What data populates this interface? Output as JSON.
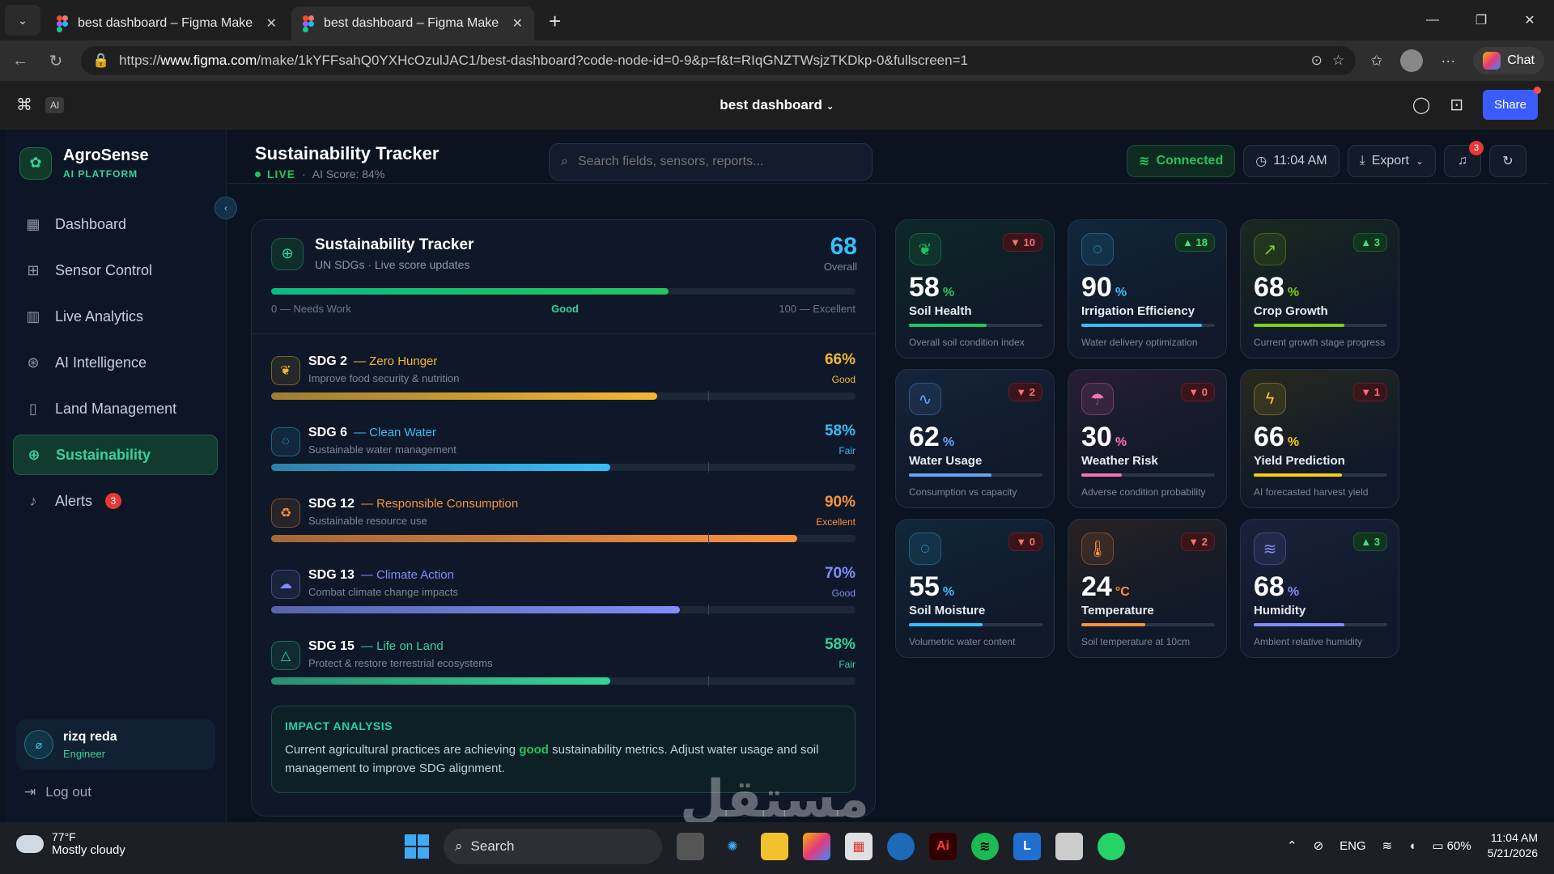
{
  "browser": {
    "tabs": [
      {
        "title": "best dashboard – Figma Make",
        "active": false
      },
      {
        "title": "best dashboard – Figma Make",
        "active": true
      }
    ],
    "url_prefix": "https://",
    "url_domain": "www.figma.com",
    "url_path": "/make/1kYFFsahQ0YXHcOzulJAC1/best-dashboard?code-node-id=0-9&p=f&t=RIqGNZTWsjzTKDkp-0&fullscreen=1",
    "chat_label": "Chat"
  },
  "figma": {
    "ai_chip": "AI",
    "file_title": "best dashboard",
    "share_label": "Share"
  },
  "sidebar": {
    "brand_name": "AgroSense",
    "brand_sub": "AI PLATFORM",
    "items": [
      {
        "label": "Dashboard",
        "icon": "grid-icon"
      },
      {
        "label": "Sensor Control",
        "icon": "cpu-icon"
      },
      {
        "label": "Live Analytics",
        "icon": "bar-chart-icon"
      },
      {
        "label": "AI Intelligence",
        "icon": "brain-icon"
      },
      {
        "label": "Land Management",
        "icon": "map-icon"
      },
      {
        "label": "Sustainability",
        "icon": "globe-icon",
        "active": true
      },
      {
        "label": "Alerts",
        "icon": "bell-icon",
        "badge": "3"
      }
    ],
    "user_name": "rizq reda",
    "user_role": "Engineer",
    "logout_label": "Log out"
  },
  "header": {
    "title": "Sustainability Tracker",
    "live": "LIVE",
    "separator": "·",
    "ai_score": "AI Score: 84%",
    "search_placeholder": "Search fields, sensors, reports...",
    "connected": "Connected",
    "time": "11:04 AM",
    "export": "Export",
    "notif_count": "3"
  },
  "tracker": {
    "title": "Sustainability Tracker",
    "subtitle": "UN SDGs · Live score updates",
    "score": "68",
    "score_label": "Overall",
    "overall_fraction": 0.68,
    "scale_low": "0 — Needs Work",
    "scale_mid": "Good",
    "scale_high": "100 — Excellent",
    "sdgs": [
      {
        "code": "SDG 2",
        "name": "— Zero Hunger",
        "desc": "Improve food security & nutrition",
        "pct": "66%",
        "level": "Good",
        "value": 66,
        "color": "#f5b731"
      },
      {
        "code": "SDG 6",
        "name": "— Clean Water",
        "desc": "Sustainable water management",
        "pct": "58%",
        "level": "Fair",
        "value": 58,
        "color": "#38bdf8"
      },
      {
        "code": "SDG 12",
        "name": "— Responsible Consumption",
        "desc": "Sustainable resource use",
        "pct": "90%",
        "level": "Excellent",
        "value": 90,
        "color": "#fb923c"
      },
      {
        "code": "SDG 13",
        "name": "— Climate Action",
        "desc": "Combat climate change impacts",
        "pct": "70%",
        "level": "Good",
        "value": 70,
        "color": "#818cf8"
      },
      {
        "code": "SDG 15",
        "name": "— Life on Land",
        "desc": "Protect & restore terrestrial ecosystems",
        "pct": "58%",
        "level": "Fair",
        "value": 58,
        "color": "#34d399"
      }
    ],
    "impact_title": "IMPACT ANALYSIS",
    "impact_text_1": "Current agricultural practices are achieving ",
    "impact_bold": "good",
    "impact_text_2": " sustainability metrics. Adjust water usage and soil management to improve SDG alignment."
  },
  "cards": [
    {
      "value": "58",
      "unit": "%",
      "name": "Soil Health",
      "desc": "Overall soil condition index",
      "delta": "▼ 10",
      "dir": "down",
      "fill": 0.58,
      "color": "#22c55e",
      "icon": "leaf-icon"
    },
    {
      "value": "90",
      "unit": "%",
      "name": "Irrigation Efficiency",
      "desc": "Water delivery optimization",
      "delta": "▲ 18",
      "dir": "up",
      "fill": 0.9,
      "color": "#38bdf8",
      "icon": "droplets-icon"
    },
    {
      "value": "68",
      "unit": "%",
      "name": "Crop Growth",
      "desc": "Current growth stage progress",
      "delta": "▲ 3",
      "dir": "up",
      "fill": 0.68,
      "color": "#84cc16",
      "icon": "trending-up-icon"
    },
    {
      "value": "62",
      "unit": "%",
      "name": "Water Usage",
      "desc": "Consumption vs capacity",
      "delta": "▼ 2",
      "dir": "down",
      "fill": 0.62,
      "color": "#60a5fa",
      "icon": "activity-icon"
    },
    {
      "value": "30",
      "unit": "%",
      "name": "Weather Risk",
      "desc": "Adverse condition probability",
      "delta": "▼ 0",
      "dir": "down",
      "fill": 0.3,
      "color": "#f472b6",
      "icon": "cloud-rain-icon"
    },
    {
      "value": "66",
      "unit": "%",
      "name": "Yield Prediction",
      "desc": "AI forecasted harvest yield",
      "delta": "▼ 1",
      "dir": "down",
      "fill": 0.66,
      "color": "#facc15",
      "icon": "zap-icon"
    },
    {
      "value": "55",
      "unit": "%",
      "name": "Soil Moisture",
      "desc": "Volumetric water content",
      "delta": "▼ 0",
      "dir": "down",
      "fill": 0.55,
      "color": "#38bdf8",
      "icon": "droplets-icon"
    },
    {
      "value": "24",
      "unit": "°C",
      "name": "Temperature",
      "desc": "Soil temperature at 10cm",
      "delta": "▼ 2",
      "dir": "down",
      "fill": 0.48,
      "color": "#fb923c",
      "icon": "thermometer-icon"
    },
    {
      "value": "68",
      "unit": "%",
      "name": "Humidity",
      "desc": "Ambient relative humidity",
      "delta": "▲ 3",
      "dir": "up",
      "fill": 0.68,
      "color": "#818cf8",
      "icon": "wind-icon"
    }
  ],
  "taskbar": {
    "temp": "77°F",
    "weather": "Mostly cloudy",
    "search": "Search",
    "lang": "ENG",
    "battery": "60%",
    "time": "11:04 AM",
    "date": "5/21/2026"
  },
  "watermark": "مستقل"
}
